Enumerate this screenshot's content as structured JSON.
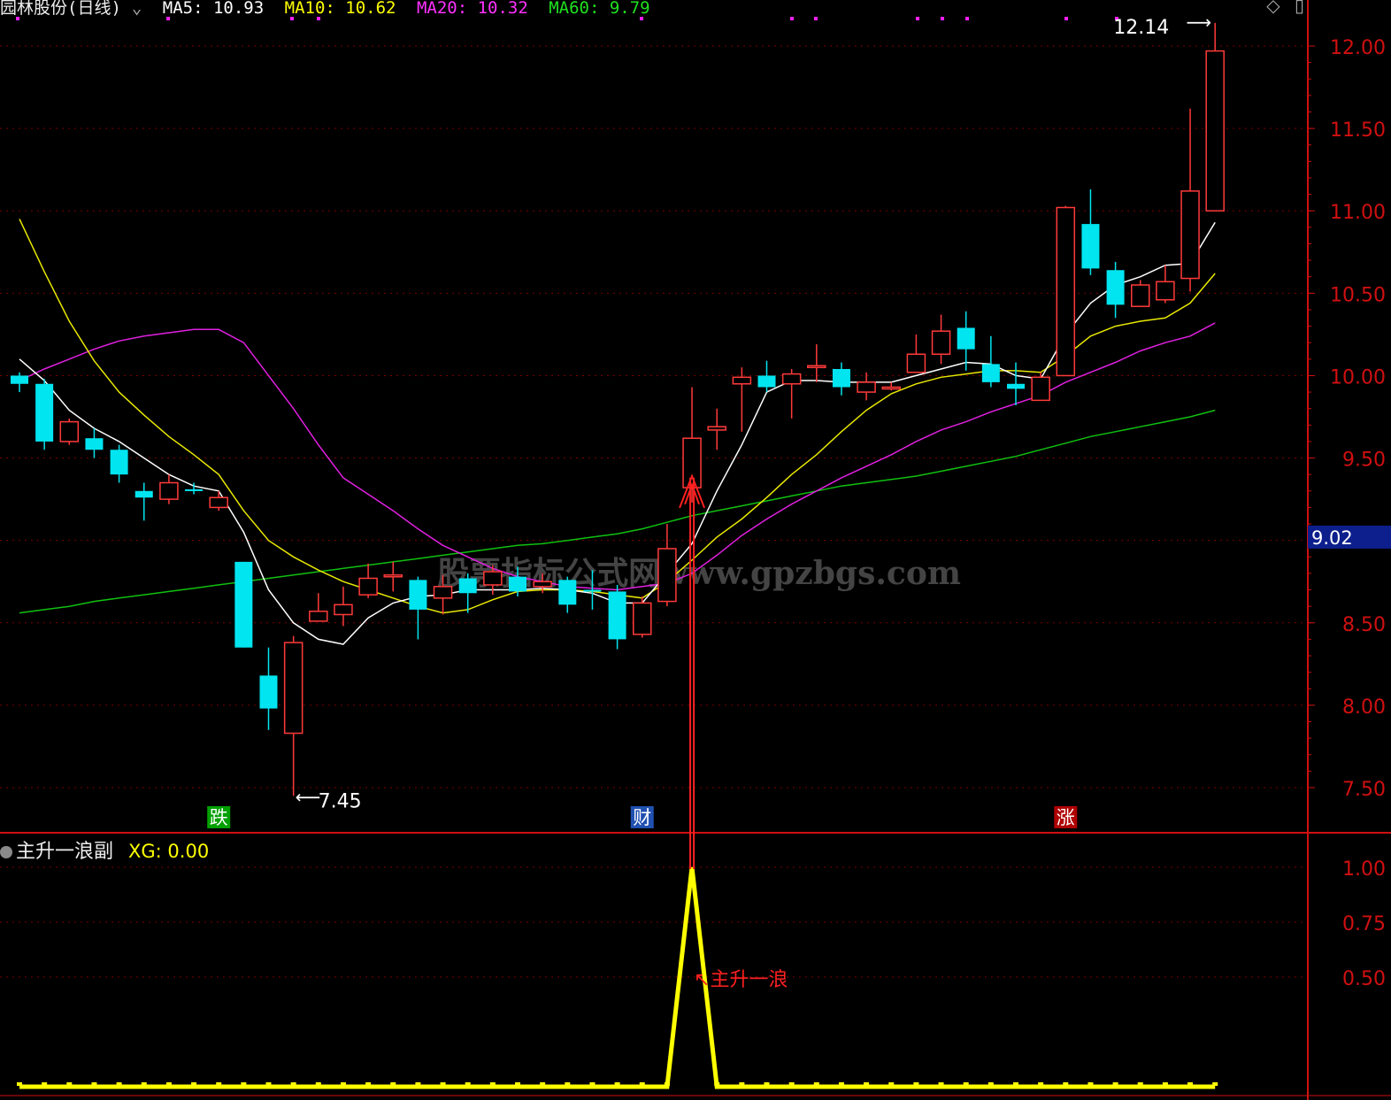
{
  "header": {
    "title": "园林股份(日线)",
    "ma5": "MA5: 10.93",
    "ma10": "MA10: 10.62",
    "ma20": "MA20: 10.32",
    "ma60": "MA60: 9.79"
  },
  "sub_header": {
    "name": "主升一浪副",
    "xg": "XG: 0.00"
  },
  "watermark": "股票指标公式网www.gpzbgs.com",
  "colors": {
    "up": "#ff3a3a",
    "down": "#00e5f0",
    "ma5": "#ffffff",
    "ma10": "#e8e800",
    "ma20": "#e020e0",
    "ma60": "#10c010",
    "axis": "#d01010",
    "signal": "#ffff00"
  },
  "chart_data": [
    {
      "type": "candlestick",
      "y_axis": {
        "ticks": [
          "12.00",
          "11.50",
          "11.00",
          "10.50",
          "10.00",
          "9.50",
          "9.00",
          "8.50",
          "8.00",
          "7.50"
        ],
        "ylim": [
          7.3,
          12.2
        ]
      },
      "current_price_label": "9.02",
      "high_label": "12.14",
      "low_label": "7.45",
      "event_markers": [
        {
          "index": 8,
          "text": "跌",
          "color": "#00a000"
        },
        {
          "index": 25,
          "text": "财",
          "color": "#2050b0"
        },
        {
          "index": 42,
          "text": "涨",
          "color": "#b00000"
        }
      ],
      "candles": [
        [
          10.0,
          9.95,
          10.02,
          9.9
        ],
        [
          9.95,
          9.6,
          9.98,
          9.55
        ],
        [
          9.6,
          9.72,
          9.74,
          9.58
        ],
        [
          9.62,
          9.55,
          9.68,
          9.5
        ],
        [
          9.55,
          9.4,
          9.58,
          9.35
        ],
        [
          9.3,
          9.26,
          9.35,
          9.12
        ],
        [
          9.25,
          9.35,
          9.4,
          9.22
        ],
        [
          9.31,
          9.3,
          9.35,
          9.28
        ],
        [
          9.2,
          9.26,
          9.3,
          9.18
        ],
        [
          8.87,
          8.35,
          8.87,
          8.35
        ],
        [
          8.18,
          7.98,
          8.35,
          7.85
        ],
        [
          7.83,
          8.38,
          8.42,
          7.45
        ],
        [
          8.51,
          8.57,
          8.68,
          8.51
        ],
        [
          8.55,
          8.61,
          8.72,
          8.48
        ],
        [
          8.67,
          8.77,
          8.86,
          8.65
        ],
        [
          8.79,
          8.79,
          8.87,
          8.69
        ],
        [
          8.76,
          8.58,
          8.78,
          8.4
        ],
        [
          8.65,
          8.72,
          8.79,
          8.55
        ],
        [
          8.77,
          8.68,
          8.8,
          8.56
        ],
        [
          8.73,
          8.81,
          8.85,
          8.67
        ],
        [
          8.78,
          8.69,
          8.84,
          8.66
        ],
        [
          8.72,
          8.75,
          8.8,
          8.68
        ],
        [
          8.76,
          8.61,
          8.78,
          8.56
        ],
        [
          8.7,
          8.69,
          8.82,
          8.58
        ],
        [
          8.69,
          8.4,
          8.73,
          8.34
        ],
        [
          8.43,
          8.62,
          8.66,
          8.41
        ],
        [
          8.63,
          8.95,
          9.1,
          8.6
        ],
        [
          9.32,
          9.62,
          9.93,
          9.23
        ],
        [
          9.67,
          9.69,
          9.8,
          9.55
        ],
        [
          9.95,
          9.99,
          10.05,
          9.66
        ],
        [
          10.0,
          9.93,
          10.09,
          9.9
        ],
        [
          9.95,
          10.01,
          10.04,
          9.74
        ],
        [
          10.06,
          10.06,
          10.19,
          9.96
        ],
        [
          10.04,
          9.93,
          10.08,
          9.88
        ],
        [
          9.9,
          9.96,
          10.02,
          9.85
        ],
        [
          9.93,
          9.93,
          9.96,
          9.91
        ],
        [
          10.02,
          10.13,
          10.25,
          10.02
        ],
        [
          10.13,
          10.27,
          10.37,
          10.07
        ],
        [
          10.29,
          10.16,
          10.39,
          10.03
        ],
        [
          10.07,
          9.96,
          10.24,
          9.93
        ],
        [
          9.95,
          9.92,
          10.08,
          9.82
        ],
        [
          9.85,
          9.99,
          10.02,
          9.85
        ],
        [
          10.0,
          11.02,
          11.03,
          10.01
        ],
        [
          10.92,
          10.65,
          11.13,
          10.61
        ],
        [
          10.64,
          10.43,
          10.69,
          10.35
        ],
        [
          10.42,
          10.55,
          10.58,
          10.45
        ],
        [
          10.46,
          10.57,
          10.67,
          10.44
        ],
        [
          10.59,
          11.12,
          11.62,
          10.51
        ],
        [
          11.0,
          11.97,
          12.14,
          11.0
        ]
      ],
      "ma5": [
        10.1,
        9.97,
        9.79,
        9.68,
        9.6,
        9.5,
        9.4,
        9.33,
        9.3,
        9.05,
        8.7,
        8.5,
        8.4,
        8.37,
        8.53,
        8.62,
        8.66,
        8.67,
        8.7,
        8.7,
        8.7,
        8.71,
        8.7,
        8.68,
        8.62,
        8.62,
        8.8,
        8.98,
        9.3,
        9.58,
        9.9,
        9.97,
        9.97,
        9.96,
        9.96,
        9.96,
        10.0,
        10.04,
        10.08,
        10.07,
        10.0,
        9.98,
        10.25,
        10.44,
        10.55,
        10.6,
        10.67,
        10.68,
        10.93
      ],
      "ma10": [
        10.95,
        10.63,
        10.33,
        10.09,
        9.9,
        9.76,
        9.63,
        9.52,
        9.4,
        9.18,
        9.0,
        8.9,
        8.82,
        8.75,
        8.7,
        8.65,
        8.6,
        8.56,
        8.58,
        8.64,
        8.69,
        8.7,
        8.7,
        8.69,
        8.67,
        8.65,
        8.75,
        8.88,
        9.02,
        9.13,
        9.26,
        9.4,
        9.52,
        9.66,
        9.79,
        9.89,
        9.95,
        9.99,
        10.01,
        10.03,
        10.03,
        10.02,
        10.12,
        10.24,
        10.3,
        10.33,
        10.35,
        10.44,
        10.62
      ],
      "ma20": [
        9.97,
        10.04,
        10.1,
        10.16,
        10.21,
        10.24,
        10.26,
        10.28,
        10.28,
        10.2,
        10.0,
        9.8,
        9.58,
        9.38,
        9.28,
        9.18,
        9.07,
        8.97,
        8.9,
        8.83,
        8.78,
        8.75,
        8.72,
        8.71,
        8.7,
        8.72,
        8.74,
        8.8,
        8.91,
        9.03,
        9.13,
        9.22,
        9.3,
        9.38,
        9.45,
        9.52,
        9.6,
        9.67,
        9.72,
        9.78,
        9.83,
        9.88,
        9.96,
        10.02,
        10.08,
        10.15,
        10.2,
        10.24,
        10.32
      ],
      "ma60": [
        8.56,
        8.58,
        8.6,
        8.63,
        8.65,
        8.67,
        8.69,
        8.71,
        8.73,
        8.75,
        8.77,
        8.79,
        8.81,
        8.83,
        8.85,
        8.87,
        8.89,
        8.91,
        8.93,
        8.95,
        8.97,
        8.98,
        9.0,
        9.02,
        9.04,
        9.07,
        9.11,
        9.15,
        9.18,
        9.21,
        9.24,
        9.27,
        9.3,
        9.33,
        9.35,
        9.37,
        9.39,
        9.42,
        9.45,
        9.48,
        9.51,
        9.55,
        9.59,
        9.63,
        9.66,
        9.69,
        9.72,
        9.75,
        9.79
      ]
    },
    {
      "type": "line",
      "name": "XG",
      "y_axis": {
        "ticks": [
          "1.00",
          "0.75",
          "0.50"
        ],
        "ylim": [
          0,
          1.1
        ]
      },
      "signal_index": 27,
      "annotation": "主升一浪",
      "values": [
        0,
        0,
        0,
        0,
        0,
        0,
        0,
        0,
        0,
        0,
        0,
        0,
        0,
        0,
        0,
        0,
        0,
        0,
        0,
        0,
        0,
        0,
        0,
        0,
        0,
        0,
        0,
        1,
        0,
        0,
        0,
        0,
        0,
        0,
        0,
        0,
        0,
        0,
        0,
        0,
        0,
        0,
        0,
        0,
        0,
        0,
        0,
        0,
        0
      ]
    }
  ]
}
